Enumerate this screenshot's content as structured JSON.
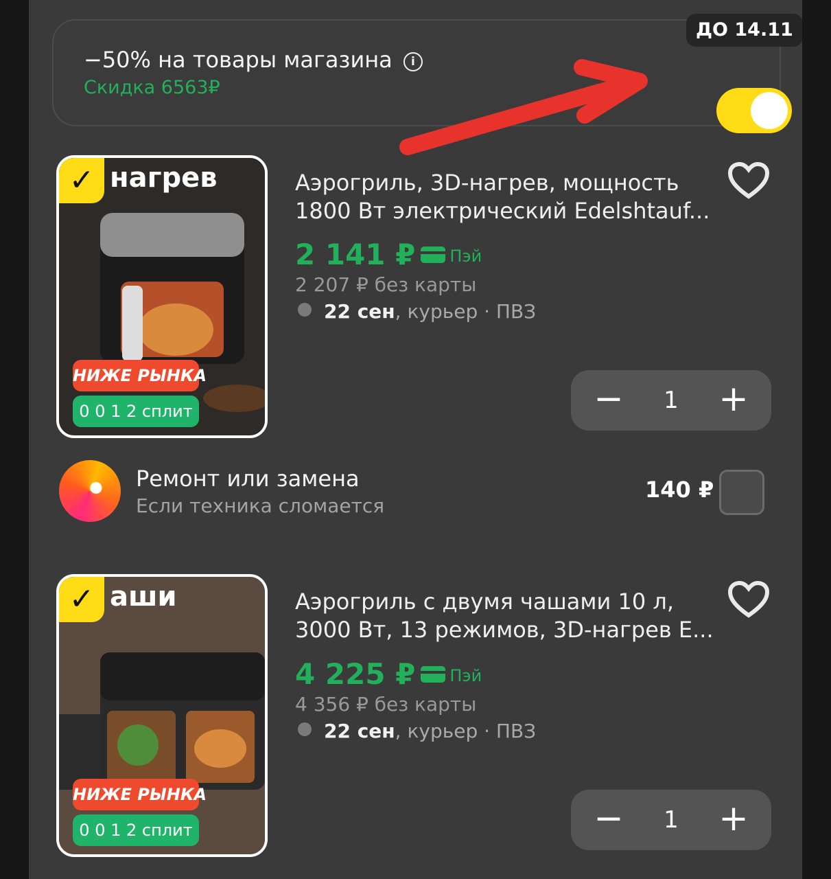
{
  "promo": {
    "title": "−50% на товары магазина",
    "info_glyph": "i",
    "discount": "Скидка 6563₽",
    "deadline": "ДО 14.11",
    "toggle_on": true,
    "accent_color": "#ffdc16",
    "annotation_color": "#e8322c"
  },
  "products": [
    {
      "selected": true,
      "thumb_heading": "нагрев",
      "thumb_badge_red": "НИЖЕ РЫНКА",
      "thumb_badge_green": "0 0 1 2 сплит",
      "title": "Аэрогриль, 3D-нагрев, мощность 1800 Вт электрический Edelshtauf...",
      "price": "2 141 ₽",
      "pay_label": "Пэй",
      "old_price": "2 207 ₽ без карты",
      "delivery_date": "22 сен",
      "delivery_rest": ", курьер · ПВЗ",
      "qty": "1",
      "minus": "−",
      "plus": "+"
    },
    {
      "selected": true,
      "thumb_heading": "аши",
      "thumb_badge_red": "НИЖЕ РЫНКА",
      "thumb_badge_green": "0 0 1 2 сплит",
      "title": "Аэрогриль с двумя чашами 10 л, 3000 Вт, 13 режимов, 3D-нагрев E...",
      "price": "4 225 ₽",
      "pay_label": "Пэй",
      "old_price": "4 356 ₽ без карты",
      "delivery_date": "22 сен",
      "delivery_rest": ", курьер · ПВЗ",
      "qty": "1",
      "minus": "−",
      "plus": "+"
    }
  ],
  "repair": {
    "title": "Ремонт или замена",
    "subtitle": "Если техника сломается",
    "price": "140 ₽",
    "checked": false
  }
}
